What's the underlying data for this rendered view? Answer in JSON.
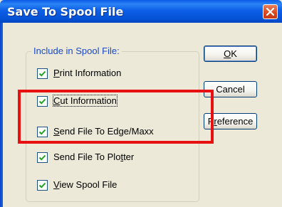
{
  "window": {
    "title": "Save To Spool File"
  },
  "group": {
    "legend": "Include in Spool File:"
  },
  "options": [
    {
      "pre": "",
      "key": "P",
      "rest": "rint Information",
      "checked": true
    },
    {
      "pre": "",
      "key": "C",
      "rest": "ut Information",
      "checked": true
    },
    {
      "pre": "",
      "key": "S",
      "rest": "end File To Edge/Maxx",
      "checked": true
    },
    {
      "pre": "Send File To Plo",
      "key": "t",
      "rest": "ter",
      "checked": true
    },
    {
      "pre": "",
      "key": "V",
      "rest": "iew Spool File",
      "checked": true
    }
  ],
  "buttons": {
    "ok": {
      "pre": "",
      "key": "O",
      "rest": "K"
    },
    "cancel": {
      "pre": "Cancel",
      "key": "",
      "rest": ""
    },
    "preference": {
      "pre": "P",
      "key": "r",
      "rest": "eference"
    }
  },
  "colors": {
    "titlebar": "#0d5fe6",
    "legend_text": "#1948c8",
    "highlight": "#e81010",
    "dialog_bg": "#ece9d8"
  }
}
